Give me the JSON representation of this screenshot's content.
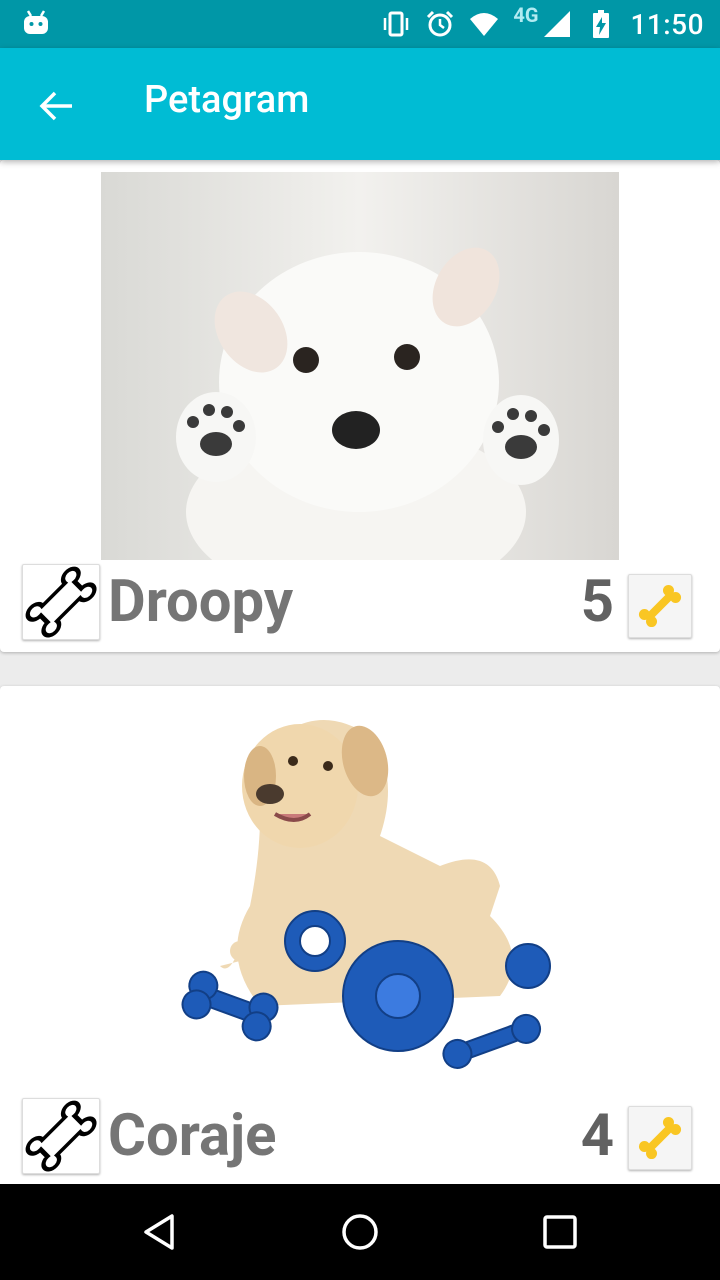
{
  "status_bar": {
    "time": "11:50",
    "network": "4G",
    "icons": [
      "android-icon",
      "vibrate-icon",
      "alarm-icon",
      "wifi-icon",
      "signal-icon",
      "battery-charging-icon"
    ]
  },
  "app_bar": {
    "title": "Petagram",
    "back_icon": "arrow-back-icon"
  },
  "pets": [
    {
      "name": "Droopy",
      "likes": "5",
      "photo": "white-puppy-photo",
      "bone_icon": "bone-outline-icon",
      "like_icon": "bone-yellow-icon"
    },
    {
      "name": "Coraje",
      "likes": "4",
      "photo": "labrador-with-toys-photo",
      "bone_icon": "bone-outline-icon",
      "like_icon": "bone-yellow-icon"
    }
  ],
  "nav_bar": {
    "icons": [
      "back-triangle-icon",
      "home-circle-icon",
      "recents-square-icon"
    ]
  },
  "colors": {
    "status_bar": "#0097a7",
    "app_bar": "#00bcd4",
    "like_bone": "#f9c623"
  }
}
